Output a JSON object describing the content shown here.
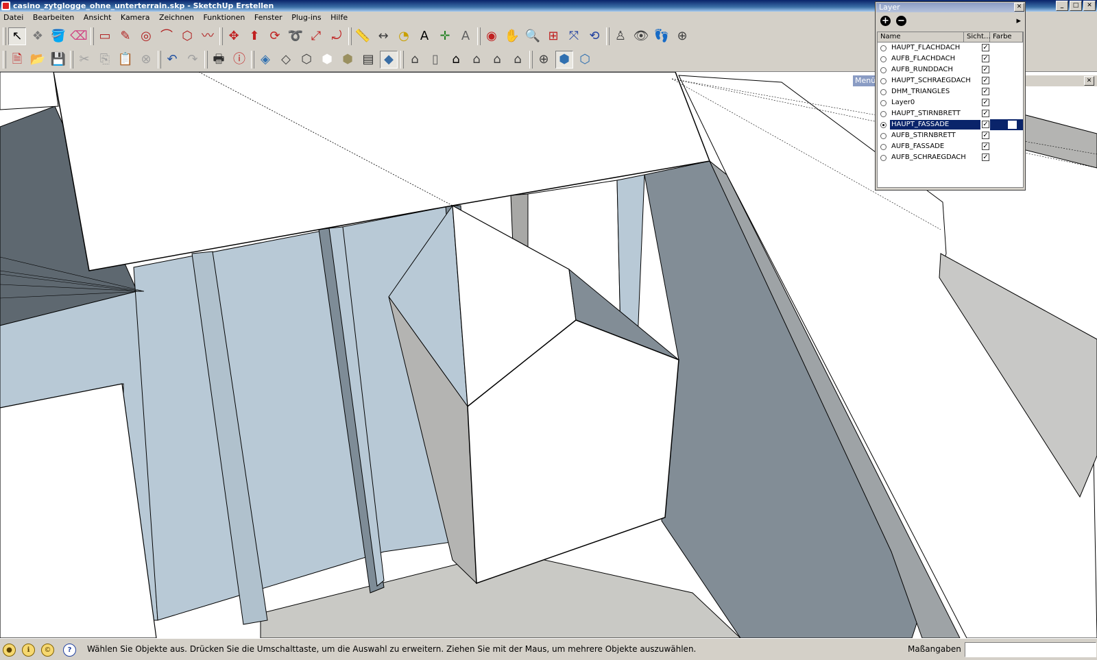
{
  "window": {
    "title": "casino_zytglogge_ohne_unterterrain.skp - SketchUp Erstellen",
    "min": "_",
    "max": "□",
    "close": "✕"
  },
  "menu": [
    "Datei",
    "Bearbeiten",
    "Ansicht",
    "Kamera",
    "Zeichnen",
    "Funktionen",
    "Fenster",
    "Plug-ins",
    "Hilfe"
  ],
  "toolbar_main": [
    {
      "icon": "select-arrow-icon",
      "glyph": "↖",
      "color": "#000000",
      "pressed": true
    },
    {
      "icon": "make-component-icon",
      "glyph": "❖",
      "color": "#7a7a7a"
    },
    {
      "icon": "paint-bucket-icon",
      "glyph": "🪣",
      "color": "#b06020"
    },
    {
      "icon": "eraser-icon",
      "glyph": "⌫",
      "color": "#d04080"
    },
    {
      "icon": "rectangle-icon",
      "glyph": "▭",
      "color": "#b02020"
    },
    {
      "icon": "line-pencil-icon",
      "glyph": "✎",
      "color": "#b02020"
    },
    {
      "icon": "circle-icon",
      "glyph": "◎",
      "color": "#b02020"
    },
    {
      "icon": "arc-icon",
      "glyph": "⌒",
      "color": "#b02020"
    },
    {
      "icon": "polygon-icon",
      "glyph": "⬡",
      "color": "#b02020"
    },
    {
      "icon": "freehand-icon",
      "glyph": "〰",
      "color": "#b02020"
    },
    {
      "icon": "move-icon",
      "glyph": "✥",
      "color": "#c02020"
    },
    {
      "icon": "push-pull-icon",
      "glyph": "⬆",
      "color": "#c02020"
    },
    {
      "icon": "rotate-icon",
      "glyph": "⟳",
      "color": "#c02020"
    },
    {
      "icon": "follow-me-icon",
      "glyph": "➰",
      "color": "#c02020"
    },
    {
      "icon": "scale-icon",
      "glyph": "⤢",
      "color": "#c02020"
    },
    {
      "icon": "offset-icon",
      "glyph": "⤾",
      "color": "#c02020"
    },
    {
      "icon": "tape-measure-icon",
      "glyph": "📏",
      "color": "#c8a000"
    },
    {
      "icon": "dimension-icon",
      "glyph": "↔",
      "color": "#404040"
    },
    {
      "icon": "protractor-icon",
      "glyph": "◔",
      "color": "#c8a000"
    },
    {
      "icon": "text-icon",
      "glyph": "A",
      "color": "#000000"
    },
    {
      "icon": "axes-icon",
      "glyph": "✛",
      "color": "#208020"
    },
    {
      "icon": "3d-text-icon",
      "glyph": "A",
      "color": "#606060"
    },
    {
      "icon": "orbit-icon",
      "glyph": "◉",
      "color": "#c02020"
    },
    {
      "icon": "pan-hand-icon",
      "glyph": "✋",
      "color": "#404040"
    },
    {
      "icon": "zoom-icon",
      "glyph": "🔍",
      "color": "#2040a0"
    },
    {
      "icon": "zoom-window-icon",
      "glyph": "⊞",
      "color": "#c02020"
    },
    {
      "icon": "zoom-extents-icon",
      "glyph": "⤧",
      "color": "#2040a0"
    },
    {
      "icon": "previous-view-icon",
      "glyph": "⟲",
      "color": "#2040a0"
    },
    {
      "icon": "position-camera-icon",
      "glyph": "♙",
      "color": "#404040"
    },
    {
      "icon": "look-around-icon",
      "glyph": "👁",
      "color": "#404040"
    },
    {
      "icon": "walk-icon",
      "glyph": "👣",
      "color": "#404040"
    },
    {
      "icon": "section-plane-icon",
      "glyph": "⊕",
      "color": "#404040"
    }
  ],
  "toolbar_secondary": [
    {
      "icon": "new-file-icon",
      "glyph": "🗎",
      "color": "#c02020"
    },
    {
      "icon": "open-folder-icon",
      "glyph": "📂",
      "color": "#c08000"
    },
    {
      "icon": "save-icon",
      "glyph": "💾",
      "color": "#2050a0"
    },
    {
      "icon": "cut-icon",
      "glyph": "✂",
      "color": "#a0a0a0",
      "dim": true
    },
    {
      "icon": "copy-icon",
      "glyph": "⎘",
      "color": "#a0a0a0",
      "dim": true
    },
    {
      "icon": "paste-icon",
      "glyph": "📋",
      "color": "#a0a0a0",
      "dim": true
    },
    {
      "icon": "delete-icon",
      "glyph": "⊗",
      "color": "#a0a0a0",
      "dim": true
    },
    {
      "icon": "undo-icon",
      "glyph": "↶",
      "color": "#2050a0"
    },
    {
      "icon": "redo-icon",
      "glyph": "↷",
      "color": "#a0a0a0",
      "dim": true
    },
    {
      "icon": "print-icon",
      "glyph": "🖶",
      "color": "#303030"
    },
    {
      "icon": "model-info-icon",
      "glyph": "ⓘ",
      "color": "#c02020"
    },
    {
      "icon": "xray-icon",
      "glyph": "◈",
      "color": "#3070b0"
    },
    {
      "icon": "back-edges-icon",
      "glyph": "◇",
      "color": "#404040"
    },
    {
      "icon": "wireframe-icon",
      "glyph": "⬡",
      "color": "#404040"
    },
    {
      "icon": "hidden-line-icon",
      "glyph": "⬢",
      "color": "#ffffff"
    },
    {
      "icon": "shaded-icon",
      "glyph": "⬢",
      "color": "#9a9060"
    },
    {
      "icon": "shaded-textures-icon",
      "glyph": "▤",
      "color": "#303030"
    },
    {
      "icon": "monochrome-icon",
      "glyph": "◆",
      "color": "#3a6ea5",
      "pressed": true
    },
    {
      "icon": "iso-view-icon",
      "glyph": "⌂",
      "color": "#404040"
    },
    {
      "icon": "top-view-icon",
      "glyph": "▯",
      "color": "#606060"
    },
    {
      "icon": "front-view-icon",
      "glyph": "⌂",
      "color": "#000000"
    },
    {
      "icon": "right-view-icon",
      "glyph": "⌂",
      "color": "#404040"
    },
    {
      "icon": "back-view-icon",
      "glyph": "⌂",
      "color": "#404040"
    },
    {
      "icon": "left-view-icon",
      "glyph": "⌂",
      "color": "#404040"
    },
    {
      "icon": "section-display-icon",
      "glyph": "⊕",
      "color": "#404040"
    },
    {
      "icon": "display-section-cuts-icon",
      "glyph": "⬢",
      "color": "#3070b0",
      "pressed": true
    },
    {
      "icon": "section-fill-icon",
      "glyph": "⬡",
      "color": "#3070b0"
    }
  ],
  "layer_panel": {
    "title": "Layer",
    "close": "✕",
    "add": "+",
    "remove": "−",
    "details": "▸",
    "col_name": "Name",
    "col_visible": "Sicht…",
    "col_color": "Farbe",
    "layers": [
      {
        "name": "HAUPT_FLACHDACH",
        "visible": "✓",
        "active": false
      },
      {
        "name": "AUFB_FLACHDACH",
        "visible": "✓",
        "active": false
      },
      {
        "name": "AUFB_RUNDDACH",
        "visible": "✓",
        "active": false
      },
      {
        "name": "HAUPT_SCHRAEGDACH",
        "visible": "✓",
        "active": false
      },
      {
        "name": "DHM_TRIANGLES",
        "visible": "✓",
        "active": false
      },
      {
        "name": "Layer0",
        "visible": "✓",
        "active": false
      },
      {
        "name": "HAUPT_STIRNBRETT",
        "visible": "✓",
        "active": false
      },
      {
        "name": "HAUPT_FASSADE",
        "visible": "✓",
        "active": true
      },
      {
        "name": "AUFB_STIRNBRETT",
        "visible": "✓",
        "active": false
      },
      {
        "name": "AUFB_FASSADE",
        "visible": "✓",
        "active": false
      },
      {
        "name": "AUFB_SCHRAEGDACH",
        "visible": "✓",
        "active": false
      }
    ]
  },
  "menu_panel": {
    "title": "Menü",
    "close": "✕"
  },
  "status": {
    "text": "Wählen Sie Objekte aus. Drücken Sie die Umschalttaste, um die Auswahl zu erweitern. Ziehen Sie mit der Maus, um mehrere Objekte auszuwählen.",
    "measure_label": "Maßangaben",
    "measure_value": "",
    "icons": [
      {
        "name": "geo-location-icon",
        "glyph": "●"
      },
      {
        "name": "credits-icon",
        "glyph": "ℹ"
      },
      {
        "name": "copyright-icon",
        "glyph": "©"
      },
      {
        "name": "help-icon",
        "glyph": "?"
      }
    ]
  },
  "colors": {
    "facade_blue": "#b8c9d6",
    "shadow_gray": "#828d96",
    "dark_gray": "#5e6870",
    "light_gray": "#c8c8c4",
    "face_white": "#ffffff"
  }
}
